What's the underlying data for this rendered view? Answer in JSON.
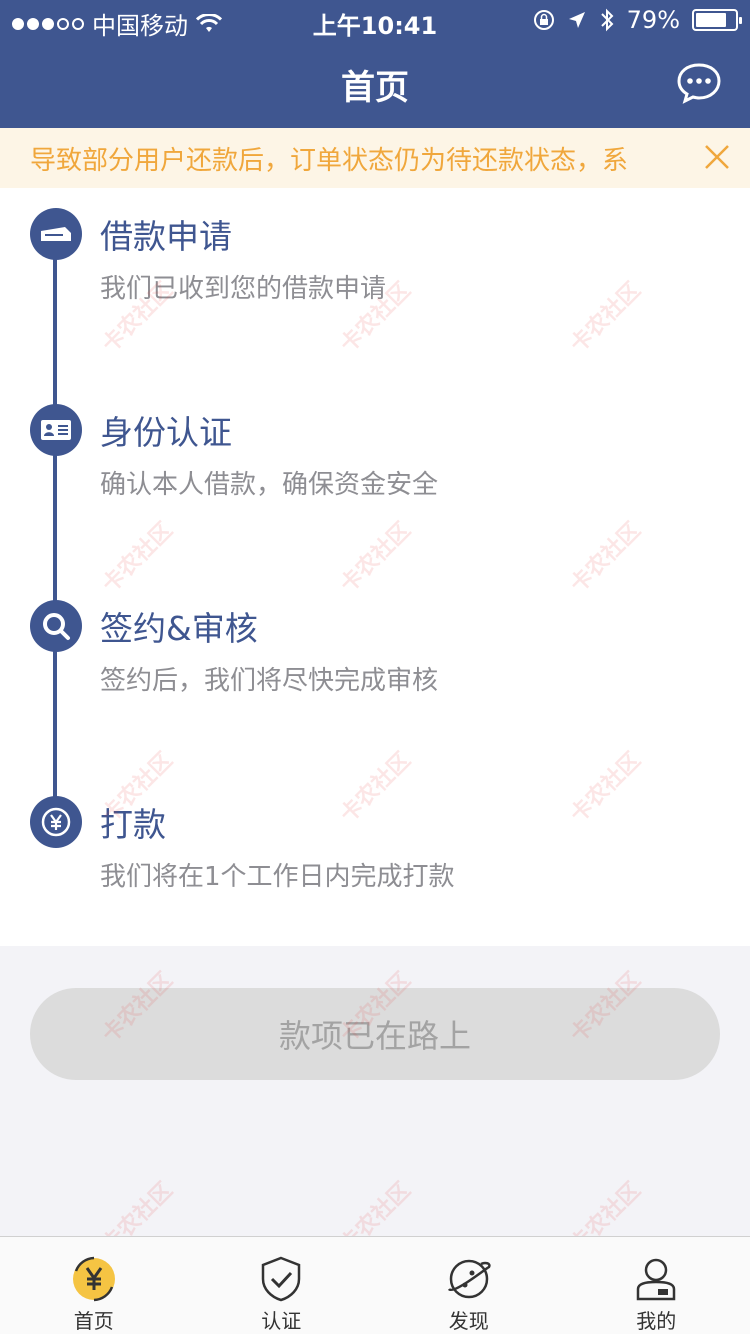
{
  "status_bar": {
    "carrier": "中国移动",
    "time": "上午10:41",
    "battery_percent": "79%",
    "battery_level": 0.79
  },
  "header": {
    "title": "首页",
    "chat_icon": "chat-bubble-icon"
  },
  "notice": {
    "text": "导致部分用户还款后，订单状态仍为待还款状态，系",
    "close_icon": "close-icon"
  },
  "steps": [
    {
      "title": "借款申请",
      "desc": "我们已收到您的借款申请",
      "icon": "ticket-icon"
    },
    {
      "title": "身份认证",
      "desc": "确认本人借款，确保资金安全",
      "icon": "id-card-icon"
    },
    {
      "title": "签约&审核",
      "desc": "签约后，我们将尽快完成审核",
      "icon": "search-icon"
    },
    {
      "title": "打款",
      "desc": "我们将在1个工作日内完成打款",
      "icon": "yuan-icon"
    }
  ],
  "action_button": {
    "label": "款项已在路上"
  },
  "tabbar": {
    "items": [
      {
        "label": "首页",
        "icon": "yuan-refresh-icon"
      },
      {
        "label": "认证",
        "icon": "shield-check-icon"
      },
      {
        "label": "发现",
        "icon": "planet-icon"
      },
      {
        "label": "我的",
        "icon": "user-icon"
      }
    ]
  },
  "colors": {
    "brand": "#3f5690",
    "notice_text": "#f0a73c",
    "notice_bg": "#fdf5e6",
    "tab_active": "#f5c443"
  },
  "watermark_text": "卡农社区"
}
